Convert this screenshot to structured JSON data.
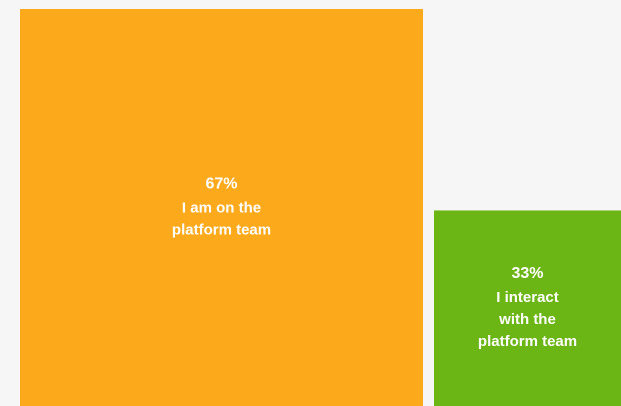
{
  "chart_data": {
    "type": "bar",
    "categories": [
      "I am on the platform team",
      "I interact with the platform team"
    ],
    "values": [
      67,
      33
    ],
    "value_labels": [
      "67%",
      "33%"
    ],
    "label_lines": [
      [
        "I am on the",
        "platform team"
      ],
      [
        "I interact",
        "with the",
        "platform team"
      ]
    ],
    "colors": [
      "#fcaa1c",
      "#6bb515"
    ],
    "ylim": [
      0,
      100
    ],
    "grid": false,
    "legend": "none"
  }
}
